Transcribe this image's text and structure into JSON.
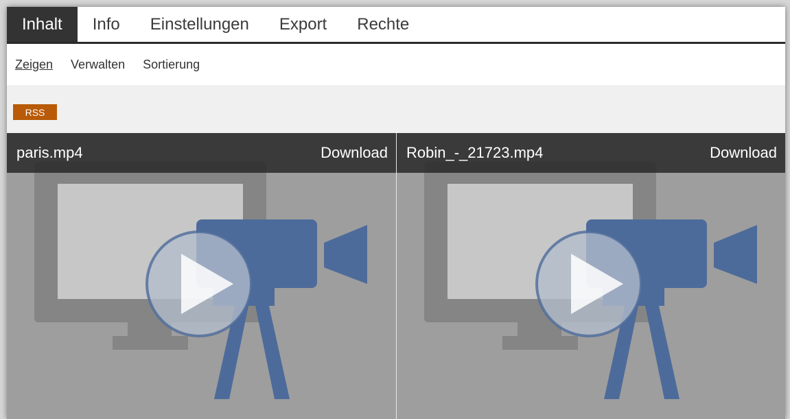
{
  "tabs": [
    {
      "label": "Inhalt",
      "active": true
    },
    {
      "label": "Info"
    },
    {
      "label": "Einstellungen"
    },
    {
      "label": "Export"
    },
    {
      "label": "Rechte"
    }
  ],
  "subnav": [
    {
      "label": "Zeigen",
      "active": true
    },
    {
      "label": "Verwalten"
    },
    {
      "label": "Sortierung"
    }
  ],
  "rss_label": "RSS",
  "media": [
    {
      "filename": "paris.mp4",
      "download_label": "Download",
      "thumbnail_icon": "video-placeholder-icon"
    },
    {
      "filename": "Robin_-_21723.mp4",
      "download_label": "Download",
      "thumbnail_icon": "video-placeholder-icon"
    }
  ],
  "colors": {
    "tab_active_bg": "#333333",
    "rss_badge": "#b85a08",
    "tile_header_bg": "#282828",
    "thumbnail_bg": "#9e9e9e",
    "camera": "#4d6b9a"
  }
}
